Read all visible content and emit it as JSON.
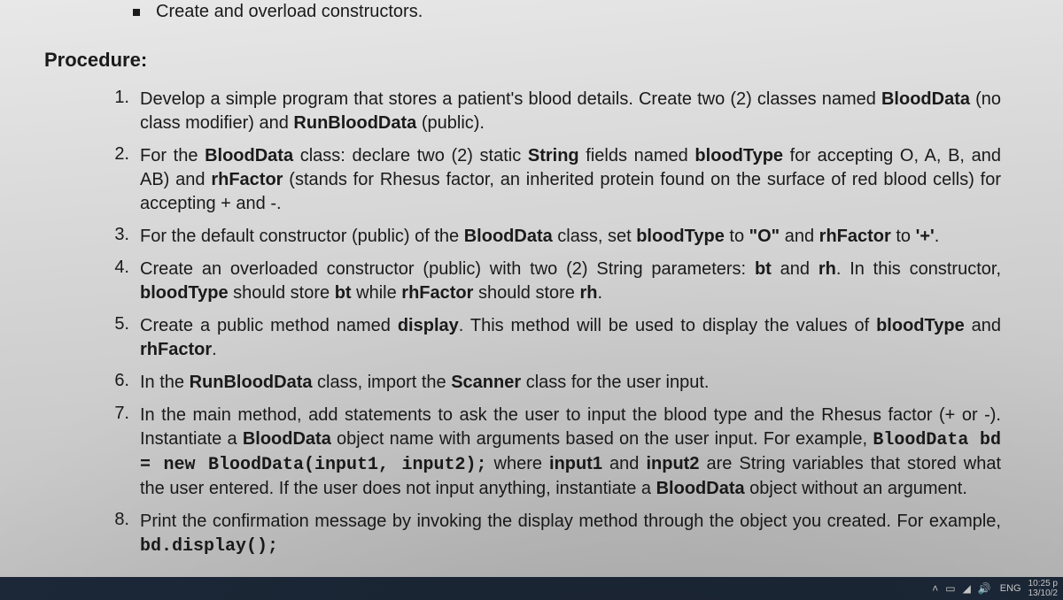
{
  "topBullet": "Create and overload constructors.",
  "procedureLabel": "Procedure:",
  "items": [
    {
      "num": "1.",
      "parts": [
        "Develop a simple program that stores a patient's blood details. Create two (2) classes named ",
        {
          "b": "BloodData"
        },
        " (no class modifier) and ",
        {
          "b": "RunBloodData"
        },
        " (public)."
      ]
    },
    {
      "num": "2.",
      "parts": [
        "For the ",
        {
          "b": "BloodData"
        },
        " class: declare two (2) static ",
        {
          "b": "String"
        },
        " fields named ",
        {
          "b": "bloodType"
        },
        " for accepting O, A, B, and AB) and ",
        {
          "b": "rhFactor"
        },
        " (stands for Rhesus factor, an inherited protein found on the surface of red blood cells) for accepting + and -."
      ]
    },
    {
      "num": "3.",
      "parts": [
        "For the default constructor (public) of the ",
        {
          "b": "BloodData"
        },
        " class, set ",
        {
          "b": "bloodType"
        },
        " to ",
        {
          "b": "\"O\""
        },
        " and ",
        {
          "b": "rhFactor"
        },
        " to ",
        {
          "b": "'+'"
        },
        "."
      ]
    },
    {
      "num": "4.",
      "parts": [
        "Create an overloaded constructor (public) with two (2) String parameters: ",
        {
          "b": "bt"
        },
        " and ",
        {
          "b": "rh"
        },
        ". In this constructor, ",
        {
          "b": "bloodType"
        },
        " should store ",
        {
          "b": "bt"
        },
        " while ",
        {
          "b": "rhFactor"
        },
        " should store ",
        {
          "b": "rh"
        },
        "."
      ]
    },
    {
      "num": "5.",
      "parts": [
        "Create a public method named ",
        {
          "b": "display"
        },
        ". This method will be used to display the values of ",
        {
          "b": "bloodType"
        },
        " and ",
        {
          "b": "rhFactor"
        },
        "."
      ]
    },
    {
      "num": "6.",
      "parts": [
        "In the ",
        {
          "b": "RunBloodData"
        },
        " class, import the ",
        {
          "b": "Scanner"
        },
        " class for the user input."
      ]
    },
    {
      "num": "7.",
      "parts": [
        "In the main method, add statements to ask the user to input the blood type and the Rhesus factor (+ or -). Instantiate a ",
        {
          "b": "BloodData"
        },
        " object name with arguments based on the user input. For example, ",
        {
          "c": "BloodData bd = new BloodData(input1, input2);"
        },
        " where ",
        {
          "b": "input1"
        },
        " and ",
        {
          "b": "input2"
        },
        " are String variables that stored what the user entered. If the user does not input anything, instantiate a ",
        {
          "b": "BloodData"
        },
        " object without an argument."
      ]
    },
    {
      "num": "8.",
      "parts": [
        "Print the confirmation message by invoking the display method through the object you created. For example, ",
        {
          "c": "bd.display();"
        }
      ]
    }
  ],
  "taskbar": {
    "lang": "ENG",
    "time": "10:25 p",
    "date": "13/10/2"
  }
}
